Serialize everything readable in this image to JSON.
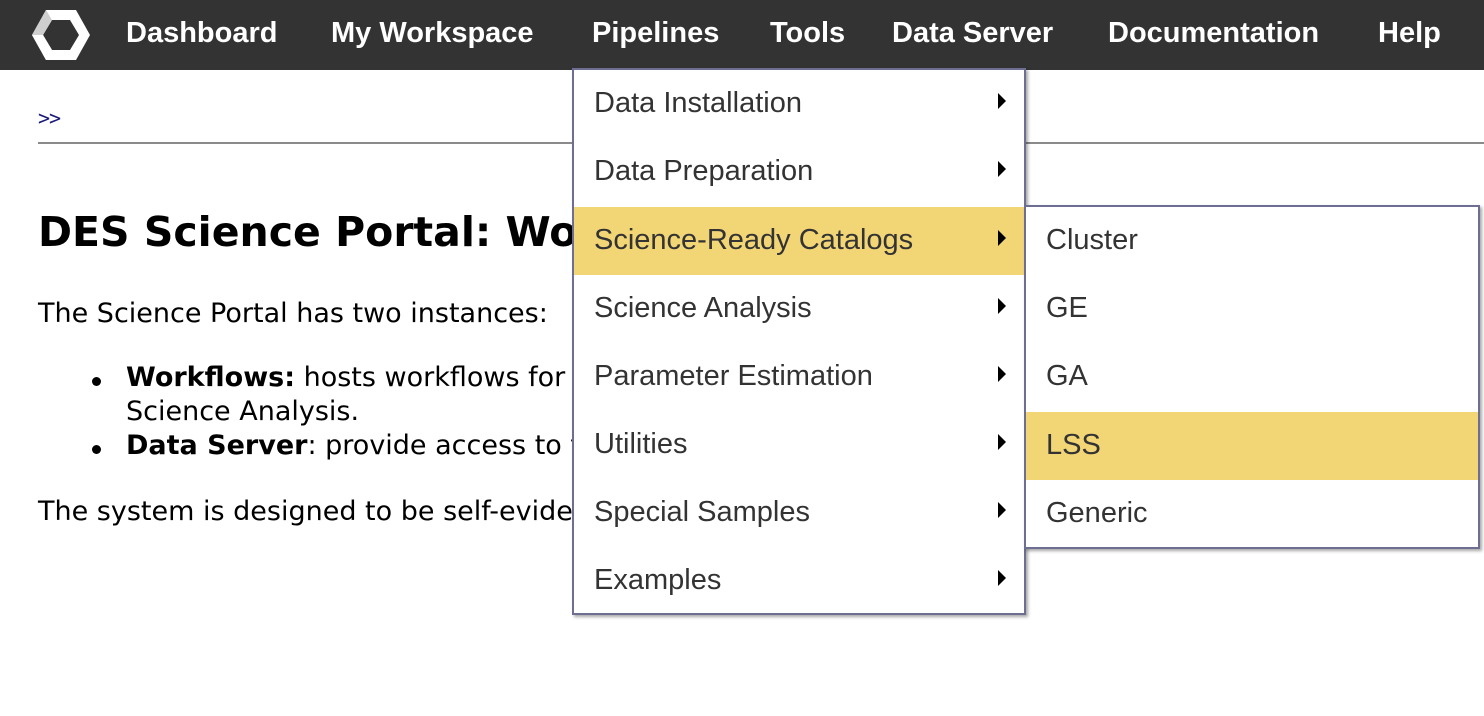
{
  "nav": {
    "items": [
      "Dashboard",
      "My Workspace",
      "Pipelines",
      "Tools",
      "Data Server",
      "Documentation",
      "Help"
    ]
  },
  "breadcrumb": ">>",
  "content": {
    "title": "DES Science Portal: Work",
    "intro": "The Science Portal has two instances:",
    "bullet1_bold": "Workflows:",
    "bullet1_text": " hosts workflows for",
    "bullet1_line2": "Science Analysis.",
    "bullet2_bold": "Data Server",
    "bullet2_text": ": provide access to t",
    "closing": "The system is designed to be self-evide"
  },
  "pipelines_menu": {
    "items": [
      "Data Installation",
      "Data Preparation",
      "Science-Ready Catalogs",
      "Science Analysis",
      "Parameter Estimation",
      "Utilities",
      "Special Samples",
      "Examples"
    ],
    "active": "Science-Ready Catalogs"
  },
  "catalogs_submenu": {
    "items": [
      "Cluster",
      "GE",
      "GA",
      "LSS",
      "Generic"
    ],
    "active": "LSS"
  },
  "colors": {
    "nav_background": "#333333",
    "highlight": "#f2d575",
    "menu_border": "#6e6e93"
  }
}
